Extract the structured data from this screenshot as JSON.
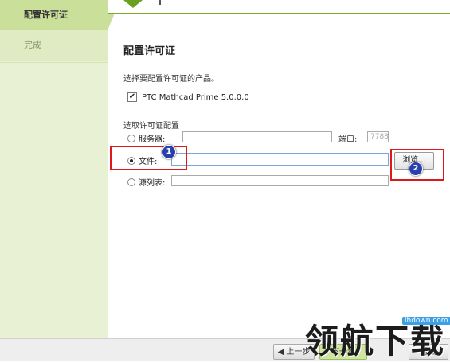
{
  "sidebar": {
    "items": [
      {
        "label": "配置许可证"
      },
      {
        "label": "完成"
      }
    ]
  },
  "main": {
    "title": "配置许可证",
    "description": "选择要配置许可证的产品。",
    "product": {
      "label": "PTC Mathcad Prime 5.0.0.0",
      "checked": true
    },
    "group_label": "选取许可证配置",
    "options": {
      "server": {
        "label": "服务器:",
        "selected": false,
        "value": ""
      },
      "port": {
        "label": "端口:",
        "placeholder": "7788"
      },
      "file": {
        "label": "文件:",
        "selected": true,
        "value": ""
      },
      "source_list": {
        "label": "源列表:",
        "selected": false,
        "value": ""
      }
    },
    "browse_label": "浏览...",
    "annotations": {
      "badge1": "1",
      "badge2": "2"
    }
  },
  "footer": {
    "prev_label": "◀ 上一步",
    "next_label": "下一步",
    "exit_label": "退出"
  },
  "watermark": {
    "text": "领航下载",
    "url": "lhdown.com"
  },
  "colors": {
    "accent": "#7aab2a",
    "sidebar_bg": "#e9f1d4",
    "highlight": "#e01818",
    "badge": "#2a3fae"
  }
}
